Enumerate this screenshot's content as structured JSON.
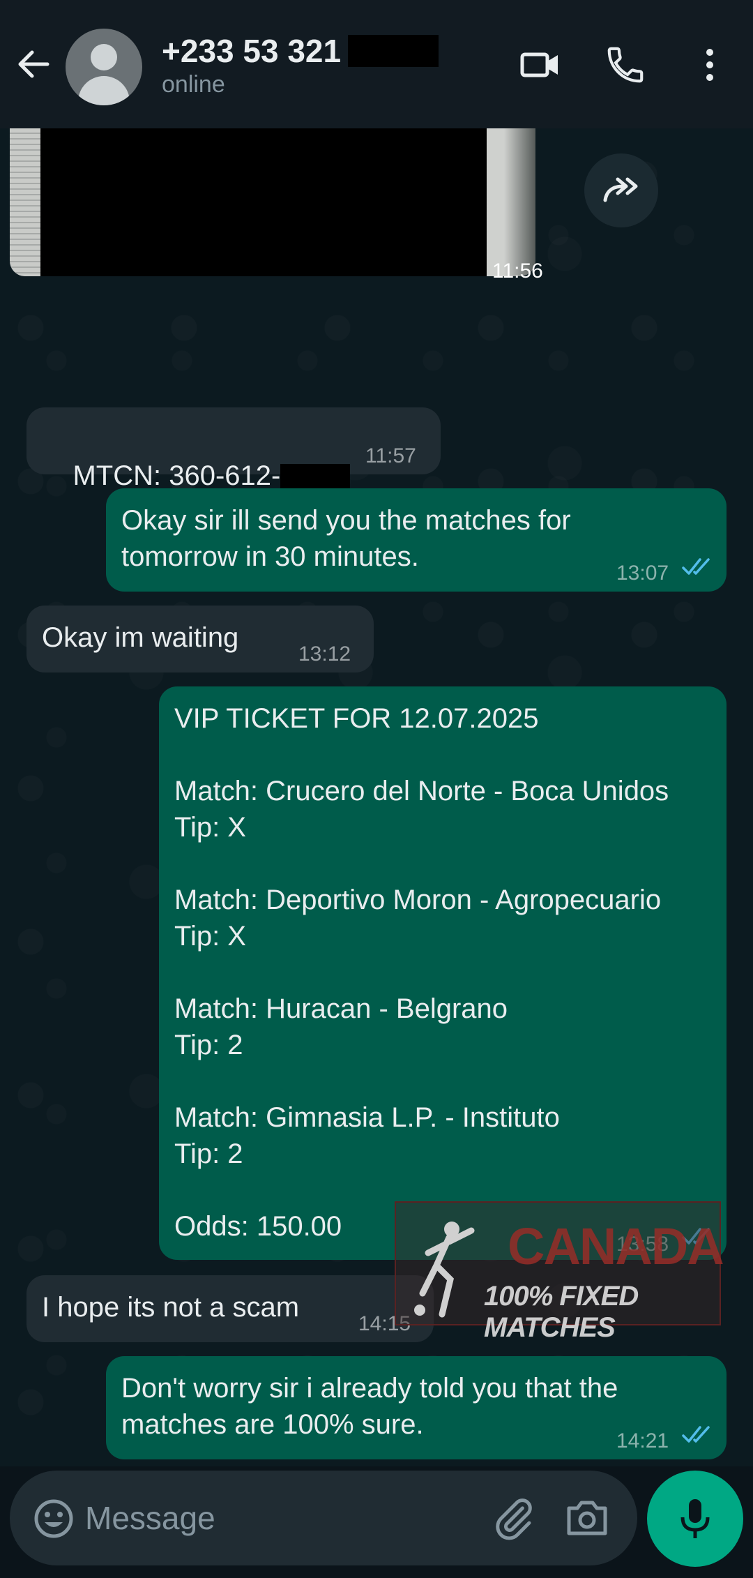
{
  "header": {
    "contact_name": "+233 53 321",
    "status": "online",
    "icons": [
      "back-arrow-icon",
      "avatar",
      "video-call-icon",
      "phone-icon",
      "more-vert-icon"
    ]
  },
  "messages": [
    {
      "type": "image",
      "direction": "in",
      "time": "11:56"
    },
    {
      "type": "text",
      "direction": "in",
      "text": "MTCN: 360-612-",
      "time": "11:57"
    },
    {
      "type": "text",
      "direction": "out",
      "text": "Okay sir ill send you the matches for\ntomorrow in 30 minutes.",
      "time": "13:07",
      "read": true
    },
    {
      "type": "text",
      "direction": "in",
      "text": "Okay im waiting",
      "time": "13:12"
    },
    {
      "type": "text",
      "direction": "out",
      "text": "VIP TICKET FOR 12.07.2025\n\nMatch: Crucero del Norte - Boca Unidos\nTip: X\n\nMatch: Deportivo Moron - Agropecuario\nTip: X\n\nMatch: Huracan - Belgrano\nTip: 2\n\nMatch: Gimnasia L.P. - Instituto\nTip: 2\n\nOdds: 150.00",
      "time": "13:58",
      "read": true
    },
    {
      "type": "text",
      "direction": "in",
      "text": "I hope its not a scam",
      "time": "14:15"
    },
    {
      "type": "text",
      "direction": "out",
      "text": "Don't worry sir i already told you that the\nmatches are 100% sure.",
      "time": "14:21",
      "read": true
    }
  ],
  "watermark": {
    "title": "CANADA",
    "subtitle": "100% FIXED MATCHES"
  },
  "input": {
    "placeholder": "Message",
    "value": ""
  },
  "colors": {
    "incoming_bubble": "#202c33",
    "outgoing_bubble": "#005c4b",
    "accent": "#00a884",
    "read_ticks": "#53bdeb"
  }
}
